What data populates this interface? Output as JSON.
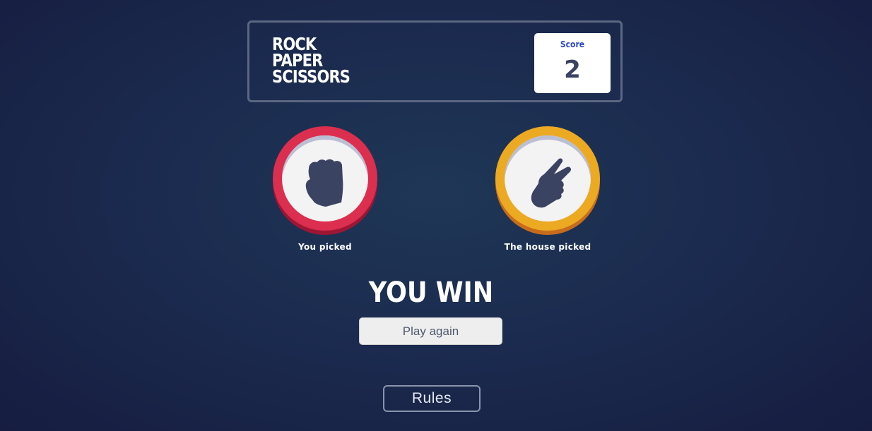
{
  "header": {
    "title_lines": [
      "ROCK",
      "PAPER",
      "SCISSORS"
    ],
    "score_label": "Score",
    "score_value": "2"
  },
  "picks": {
    "player": {
      "label": "You picked",
      "choice": "rock",
      "icon": "rock-hand-icon",
      "color": "#dc2e4e"
    },
    "house": {
      "label": "The house picked",
      "choice": "scissors",
      "icon": "scissors-hand-icon",
      "color": "#eca922"
    }
  },
  "result": {
    "text": "YOU WIN",
    "play_again_label": "Play again"
  },
  "footer": {
    "rules_label": "Rules"
  }
}
